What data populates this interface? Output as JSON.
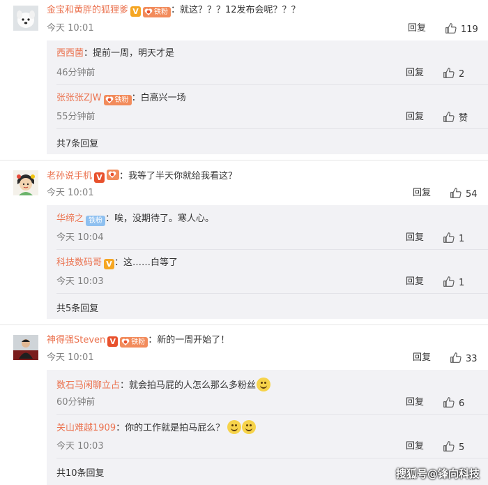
{
  "comments": [
    {
      "user": "金宝和黄胖的狐狸爹",
      "text": "：就这？？？12发布会呢？？？",
      "time": "今天 10:01",
      "reply_label": "回复",
      "likes": "119",
      "fan_label": "铁粉",
      "replies": [
        {
          "user": "西西菌",
          "text": "：提前一周，明天才是",
          "time": "46分钟前",
          "reply_label": "回复",
          "likes": "2"
        },
        {
          "user": "张张张ZJW",
          "text": "：白高兴一场",
          "time": "55分钟前",
          "reply_label": "回复",
          "likes": "赞",
          "fan_label": "铁粉"
        }
      ],
      "more": "共7条回复"
    },
    {
      "user": "老孙说手机",
      "text": "：我等了半天你就给我看这？",
      "time": "今天 10:01",
      "reply_label": "回复",
      "likes": "54",
      "replies": [
        {
          "user": "华缔之",
          "fan_label": "铁粉",
          "text": "：唉，没期待了。寒人心。",
          "time": "今天 10:04",
          "reply_label": "回复",
          "likes": "1"
        },
        {
          "user": "科技数码哥",
          "text": "：这……白等了",
          "time": "今天 10:03",
          "reply_label": "回复",
          "likes": "1"
        }
      ],
      "more": "共5条回复"
    },
    {
      "user": "神得强Steven",
      "text": "：新的一周开始了！",
      "time": "今天 10:01",
      "reply_label": "回复",
      "likes": "33",
      "fan_label": "铁粉",
      "replies": [
        {
          "user": "数石马闲聊立占",
          "text": "：就会拍马屁的人怎么那么多粉丝",
          "time": "60分钟前",
          "reply_label": "回复",
          "likes": "6"
        },
        {
          "user": "关山难越1909",
          "text": "：你的工作就是拍马屁么？",
          "time": "今天 10:03",
          "reply_label": "回复",
          "likes": "5"
        }
      ],
      "more": "共10条回复"
    }
  ],
  "watermark": "搜狐号@锋向科技",
  "colors": {
    "username": "#eb7350",
    "reply_username": "#eb7350",
    "reply_bg": "#f2f2f5",
    "v_badge": "#f5a623"
  }
}
